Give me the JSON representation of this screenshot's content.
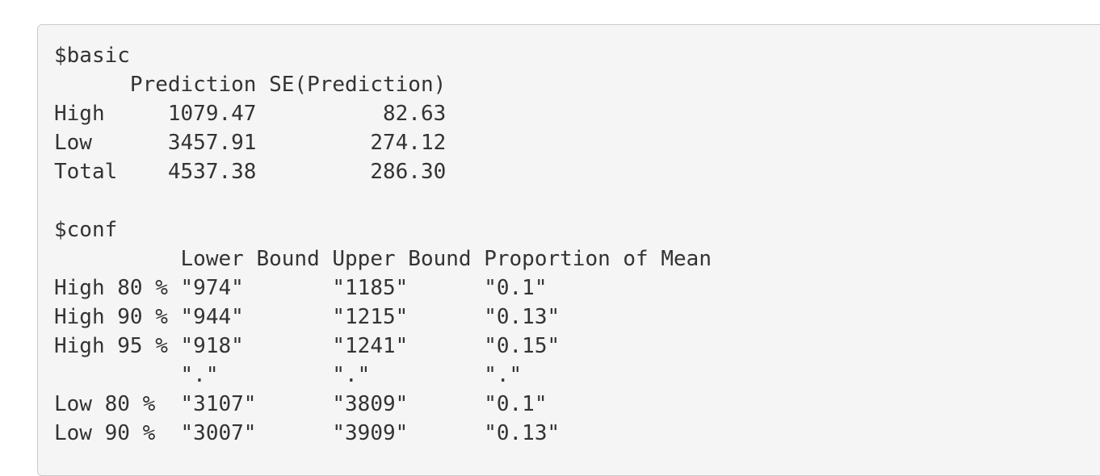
{
  "lines": [
    "$basic",
    "      Prediction SE(Prediction)",
    "High     1079.47          82.63",
    "Low      3457.91         274.12",
    "Total    4537.38         286.30",
    "",
    "$conf",
    "          Lower Bound Upper Bound Proportion of Mean",
    "High 80 % \"974\"       \"1185\"      \"0.1\"",
    "High 90 % \"944\"       \"1215\"      \"0.13\"",
    "High 95 % \"918\"       \"1241\"      \"0.15\"",
    "          \".\"         \".\"         \".\"",
    "Low 80 %  \"3107\"      \"3809\"      \"0.1\"",
    "Low 90 %  \"3007\"      \"3909\"      \"0.13\""
  ]
}
